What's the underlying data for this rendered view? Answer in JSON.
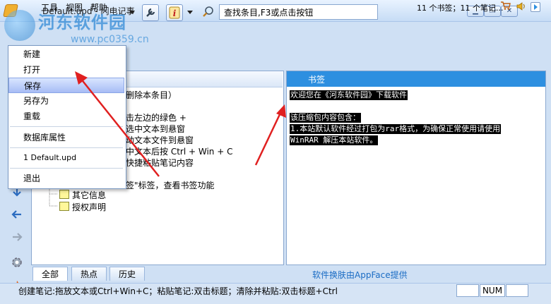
{
  "window": {
    "title": "Default.upd - 闪电记事",
    "minimize_label": "▁",
    "restore_label": "❐",
    "close_label": "✕"
  },
  "watermark": {
    "text": "河东软件园",
    "url": "www.pc0359.cn"
  },
  "menubar": {
    "items": [
      "工具",
      "视图",
      "帮助"
    ],
    "count_text": "11 个书签；11 个笔记..."
  },
  "toolbar": {
    "search_text": "查找条目,F3或点击按钮",
    "icons": [
      "wrench-icon",
      "info-icon",
      "search-icon"
    ]
  },
  "file_menu": {
    "items": [
      "新建",
      "打开",
      "保存",
      "另存为",
      "重载",
      "数据库属性",
      "1 Default.upd",
      "退出"
    ],
    "selected": "保存"
  },
  "tree": {
    "lines": [
      "删除本条目）",
      "击左边的绿色 +",
      "选中文本到悬窗",
      "动文本文件到悬窗",
      "中文本后按 Ctrl + Win + C",
      "快捷粘贴笔记内容",
      "签\"标签，查看书签功能"
    ],
    "folders": [
      "其它信息",
      "授权声明"
    ]
  },
  "bookmark": {
    "header": "书签",
    "lines": [
      "欢迎您在《河东软件园》下载软件",
      " ",
      "该压缩包内容包含：",
      "1.本站默认软件经过打包为rar格式，为确保正常使用请使用",
      "WinRAR 解压本站软件。"
    ]
  },
  "tabs": [
    "全部",
    "热点",
    "历史"
  ],
  "skin_text": "软件换肤由AppFace提供",
  "status": {
    "text": "创建笔记:拖放文本或Ctrl+Win+C；粘贴笔记:双击标题；清除并粘贴:双击标题+Ctrl",
    "num": "NUM"
  },
  "colors": {
    "accent": "#2d8fe0",
    "highlight": "#a7bcf5",
    "arrow": "#e02020"
  }
}
